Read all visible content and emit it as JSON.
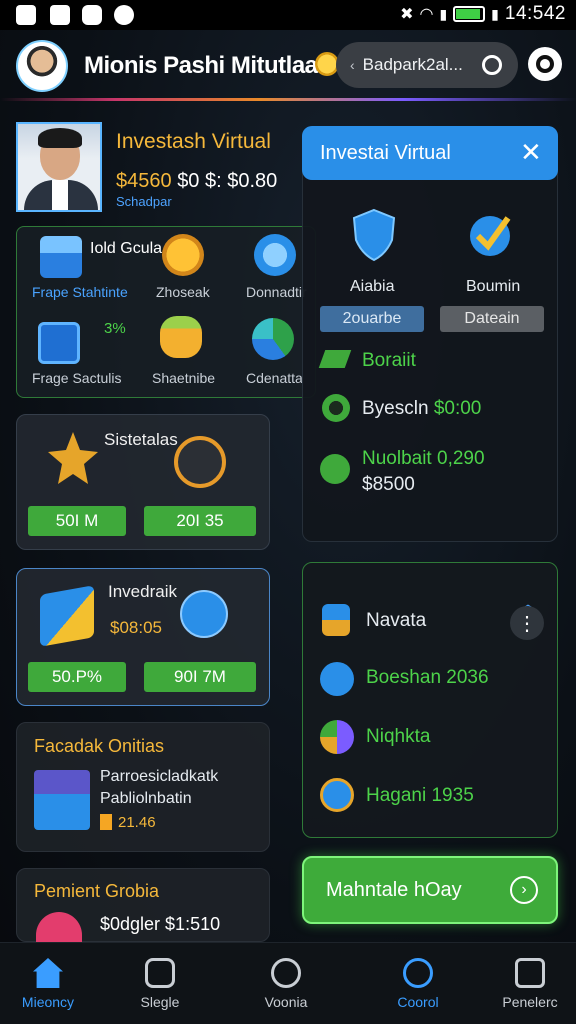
{
  "status_bar": {
    "time": "14:542"
  },
  "header": {
    "title": "Mionis Pashi Mitutlaai",
    "search_text": "Badpark2al..."
  },
  "profile": {
    "title": "Investash Virtual",
    "balance_gold": "$4560",
    "balance_rest": "$0 $: $0.80",
    "subtitle": "Schadpar"
  },
  "grid": {
    "items": [
      {
        "label": "Frape Stahtinte",
        "icon": "bar-chart-icon"
      },
      {
        "label": "Iold Gcula",
        "icon": ""
      },
      {
        "label": "Zhoseak",
        "icon": "coin-icon"
      },
      {
        "label": "Donnadtir",
        "icon": "bank-icon"
      },
      {
        "label": "Frage Sactulis",
        "icon": "monitor-icon"
      },
      {
        "label": "3%",
        "icon": ""
      },
      {
        "label": "Shaetnibe",
        "icon": "coins-stack-icon"
      },
      {
        "label": "Cdenatta",
        "icon": "pie-chart-icon"
      }
    ]
  },
  "panel": {
    "title": "Investai Virtual",
    "left_label": "Aiabia",
    "right_label": "Boumin",
    "left_chip": "2ouarbe",
    "right_chip": "Dateain",
    "rows": [
      {
        "label": "Boraiit",
        "value": ""
      },
      {
        "label": "Byescln",
        "value": "$0:00"
      },
      {
        "label": "Nuolbait",
        "value": "0,290",
        "sub": "$8500"
      }
    ]
  },
  "card1": {
    "title": "Sistetalas",
    "btn1": "50I M",
    "btn2": "20I 35"
  },
  "card2": {
    "title": "Invedraik",
    "value": "$08:05",
    "btn1": "50.P%",
    "btn2": "90I 7M"
  },
  "nav_panel": {
    "items": [
      {
        "label": "Navata"
      },
      {
        "label": "Boeshan 2036"
      },
      {
        "label": "Niqhkta"
      },
      {
        "label": "Hagani 1935"
      }
    ]
  },
  "card3": {
    "title": "Facadak Onitias",
    "line1": "Parroesicladkatk",
    "line2": "Pabliolnbatin",
    "value": "21.46"
  },
  "card4": {
    "title": "Pemient Grobia",
    "value": "$0dgler $1:510"
  },
  "cta": {
    "label": "Mahntale hOay"
  },
  "tabs": [
    {
      "label": "Mieoncy",
      "active": true
    },
    {
      "label": "Slegle",
      "active": false
    },
    {
      "label": "Voonia",
      "active": false
    },
    {
      "label": "Coorol",
      "active": false
    },
    {
      "label": "Penelerc",
      "active": false
    }
  ],
  "colors": {
    "accent_blue": "#2a8fe8",
    "accent_green": "#3fa93b",
    "gold": "#f5b83b"
  }
}
